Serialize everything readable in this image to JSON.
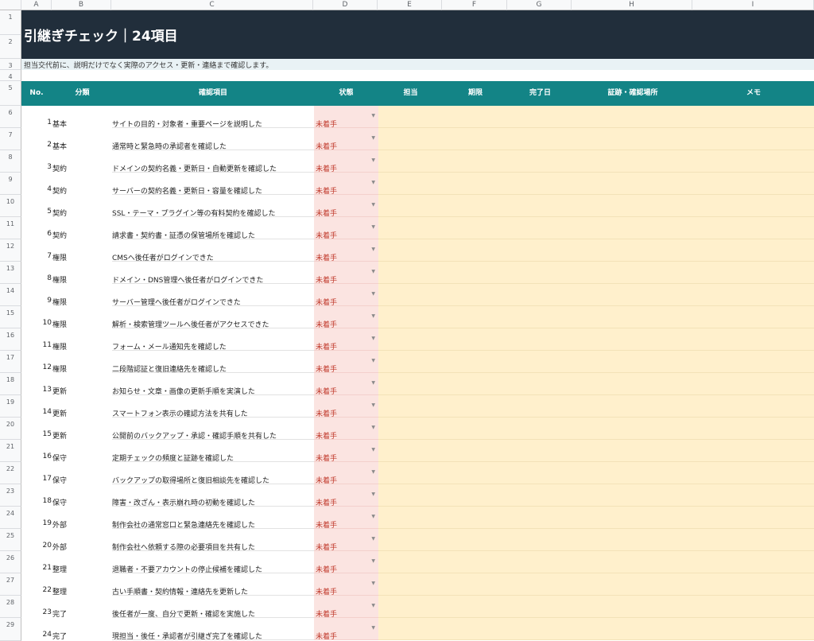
{
  "columns": [
    "A",
    "B",
    "C",
    "D",
    "E",
    "F",
    "G",
    "H",
    "I"
  ],
  "row_numbers": [
    "1",
    "2",
    "3",
    "4",
    "5",
    "6",
    "7",
    "8",
    "9",
    "10",
    "11",
    "12",
    "13",
    "14",
    "15",
    "16",
    "17",
    "18",
    "19",
    "20",
    "21",
    "22",
    "23",
    "24",
    "25",
    "26",
    "27",
    "28",
    "29"
  ],
  "title": "引継ぎチェック｜24項目",
  "subtitle": "担当交代前に、説明だけでなく実際のアクセス・更新・連絡まで確認します。",
  "headers": {
    "no": "No.",
    "category": "分類",
    "item": "確認項目",
    "status": "状態",
    "owner": "担当",
    "deadline": "期限",
    "done_date": "完了日",
    "evidence": "証跡・確認場所",
    "memo": "メモ"
  },
  "rows": [
    {
      "no": "1",
      "category": "基本",
      "item": "サイトの目的・対象者・重要ページを説明した",
      "status": "未着手"
    },
    {
      "no": "2",
      "category": "基本",
      "item": "通常時と緊急時の承認者を確認した",
      "status": "未着手"
    },
    {
      "no": "3",
      "category": "契約",
      "item": "ドメインの契約名義・更新日・自動更新を確認した",
      "status": "未着手"
    },
    {
      "no": "4",
      "category": "契約",
      "item": "サーバーの契約名義・更新日・容量を確認した",
      "status": "未着手"
    },
    {
      "no": "5",
      "category": "契約",
      "item": "SSL・テーマ・プラグイン等の有料契約を確認した",
      "status": "未着手"
    },
    {
      "no": "6",
      "category": "契約",
      "item": "請求書・契約書・証憑の保管場所を確認した",
      "status": "未着手"
    },
    {
      "no": "7",
      "category": "権限",
      "item": "CMSへ後任者がログインできた",
      "status": "未着手"
    },
    {
      "no": "8",
      "category": "権限",
      "item": "ドメイン・DNS管理へ後任者がログインできた",
      "status": "未着手"
    },
    {
      "no": "9",
      "category": "権限",
      "item": "サーバー管理へ後任者がログインできた",
      "status": "未着手"
    },
    {
      "no": "10",
      "category": "権限",
      "item": "解析・検索管理ツールへ後任者がアクセスできた",
      "status": "未着手"
    },
    {
      "no": "11",
      "category": "権限",
      "item": "フォーム・メール通知先を確認した",
      "status": "未着手"
    },
    {
      "no": "12",
      "category": "権限",
      "item": "二段階認証と復旧連絡先を確認した",
      "status": "未着手"
    },
    {
      "no": "13",
      "category": "更新",
      "item": "お知らせ・文章・画像の更新手順を実演した",
      "status": "未着手"
    },
    {
      "no": "14",
      "category": "更新",
      "item": "スマートフォン表示の確認方法を共有した",
      "status": "未着手"
    },
    {
      "no": "15",
      "category": "更新",
      "item": "公開前のバックアップ・承認・確認手順を共有した",
      "status": "未着手"
    },
    {
      "no": "16",
      "category": "保守",
      "item": "定期チェックの頻度と証跡を確認した",
      "status": "未着手"
    },
    {
      "no": "17",
      "category": "保守",
      "item": "バックアップの取得場所と復旧相談先を確認した",
      "status": "未着手"
    },
    {
      "no": "18",
      "category": "保守",
      "item": "障害・改ざん・表示崩れ時の初動を確認した",
      "status": "未着手"
    },
    {
      "no": "19",
      "category": "外部",
      "item": "制作会社の通常窓口と緊急連絡先を確認した",
      "status": "未着手"
    },
    {
      "no": "20",
      "category": "外部",
      "item": "制作会社へ依頼する際の必要項目を共有した",
      "status": "未着手"
    },
    {
      "no": "21",
      "category": "整理",
      "item": "退職者・不要アカウントの停止候補を確認した",
      "status": "未着手"
    },
    {
      "no": "22",
      "category": "整理",
      "item": "古い手順書・契約情報・連絡先を更新した",
      "status": "未着手"
    },
    {
      "no": "23",
      "category": "完了",
      "item": "後任者が一度、自分で更新・確認を実施した",
      "status": "未着手"
    },
    {
      "no": "24",
      "category": "完了",
      "item": "現担当・後任・承認者が引継ぎ完了を確認した",
      "status": "未着手"
    }
  ],
  "colors": {
    "title_bg": "#212e3b",
    "header_bg": "#138486",
    "status_fill": "#fbe4e1",
    "status_text": "#c0392b",
    "input_fill": "#fff0cc"
  }
}
